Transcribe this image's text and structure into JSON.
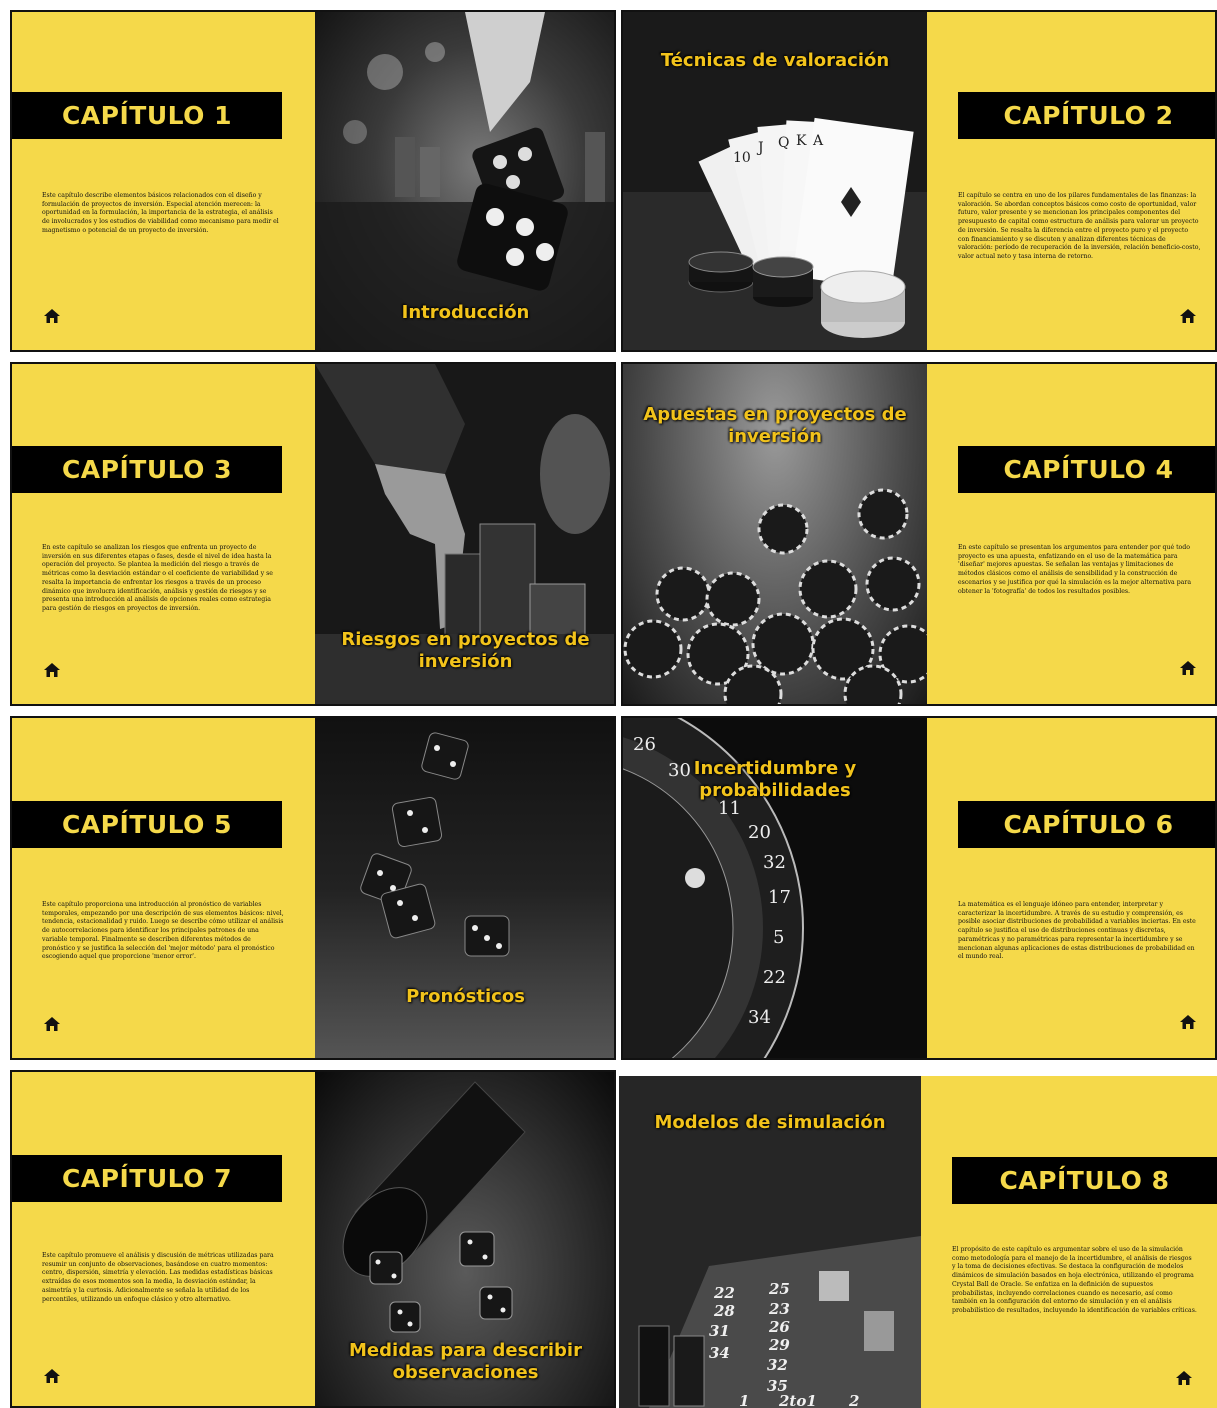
{
  "colors": {
    "accent_yellow": "#f5d94a",
    "band_black": "#000000",
    "photo_title_yellow": "#f2c31b"
  },
  "cards": [
    {
      "chapter": "CAPÍTULO 1",
      "photo_title": "Introducción",
      "description": "Este capítulo describe elementos básicos relacionados con el diseño y formulación de proyectos de inversión. Especial atención merecen: la oportunidad en la formulación, la importancia de la estrategia, el análisis de involucrados y los estudios de viabilidad como mecanismo para medir el magnetismo o potencial de un proyecto de inversión.",
      "icon": "home-icon"
    },
    {
      "chapter": "CAPÍTULO 2",
      "photo_title": "Técnicas de valoración",
      "description": "El capítulo se centra en uno de los pilares fundamentales de las finanzas: la valoración. Se abordan conceptos básicos como costo de oportunidad, valor futuro, valor presente y se mencionan los principales componentes del presupuesto de capital como estructura de análisis para valorar un proyecto de inversión. Se resalta la diferencia entre el proyecto puro y el proyecto con financiamiento y se discuten y analizan diferentes técnicas de valoración: período de recuperación de la inversión, relación beneficio-costo, valor actual neto y tasa interna de retorno.",
      "icon": "home-icon"
    },
    {
      "chapter": "CAPÍTULO 3",
      "photo_title": "Riesgos en proyectos de inversión",
      "description": "En este capítulo se analizan los riesgos que enfrenta un proyecto de inversión en sus diferentes etapas o fases, desde el nivel de idea hasta la operación del proyecto. Se plantea la medición del riesgo a través de métricas como la desviación estándar o el coeficiente de variabilidad y se resalta la importancia de enfrentar los riesgos a través de un proceso dinámico que involucra identificación, análisis y gestión de riesgos y se presenta una introducción al análisis de opciones reales como estrategia para gestión de riesgos en proyectos de inversión.",
      "icon": "home-icon"
    },
    {
      "chapter": "CAPÍTULO 4",
      "photo_title": "Apuestas en proyectos de inversión",
      "description": "En este capítulo se presentan los argumentos para entender por qué todo proyecto es una apuesta, enfatizando en el uso de la matemática para 'diseñar' mejores apuestas. Se señalan las ventajas y limitaciones de métodos clásicos como el análisis de sensibilidad y la construcción de escenarios y se justifica por qué la simulación es la mejor alternativa para obtener la 'fotografía' de todos los resultados posibles.",
      "icon": "home-icon"
    },
    {
      "chapter": "CAPÍTULO 5",
      "photo_title": "Pronósticos",
      "description": "Este capítulo proporciona una introducción al pronóstico de variables temporales, empezando por una descripción de sus elementos básicos: nivel, tendencia, estacionalidad y ruido. Luego se describe cómo utilizar el análisis de autocorrelaciones para identificar los principales patrones de una variable temporal. Finalmente se describen diferentes métodos de pronóstico y se justifica la selección del 'mejor método' para el pronóstico escogiendo aquel que proporcione 'menor error'.",
      "icon": "home-icon"
    },
    {
      "chapter": "CAPÍTULO 6",
      "photo_title": "Incertidumbre y probabilidades",
      "description": "La matemática es el lenguaje idóneo para entender, interpretar y caracterizar la incertidumbre. A través de su estudio y comprensión, es posible asociar distribuciones de probabilidad a variables inciertas. En este capítulo se justifica el uso de distribuciones continuas y discretas, paramétricas y no paramétricas para representar la incertidumbre y se mencionan algunas aplicaciones de estas distribuciones de probabilidad en el mundo real.",
      "icon": "home-icon"
    },
    {
      "chapter": "CAPÍTULO 7",
      "photo_title": "Medidas para describir observaciones",
      "description": "Este capítulo promueve el análisis y discusión de métricas utilizadas para resumir un conjunto de observaciones, basándose en cuatro momentos: centro, dispersión, simetría y elevación. Las medidas estadísticas básicas extraídas de esos momentos son la media, la desviación estándar, la asimetría y la curtosis. Adicionalmente se señala la utilidad de los percentiles, utilizando un enfoque clásico y otro alternativo.",
      "icon": "home-icon"
    },
    {
      "chapter": "CAPÍTULO 8",
      "photo_title": "Modelos de simulación",
      "description": "El propósito de este capítulo es argumentar sobre el uso de la simulación como metodología para el manejo de la incertidumbre, el análisis de riesgos y la toma de decisiones efectivas. Se destaca la configuración de modelos dinámicos de simulación basados en hoja electrónica, utilizando el programa Crystal Ball de Oracle. Se enfatiza en la definición de supuestos probabilistas, incluyendo correlaciones cuando es necesario, así como también en la configuración del entorno de simulación y en el análisis probabilístico de resultados, incluyendo la identificación de variables críticas.",
      "icon": "home-icon"
    }
  ],
  "photo_details": {
    "card2_cards": [
      "10",
      "J",
      "Q",
      "K",
      "A"
    ],
    "card6_numbers": [
      "26",
      "30",
      "11",
      "20",
      "32",
      "17",
      "5",
      "22",
      "34"
    ],
    "card8_table_numbers": [
      "22",
      "25",
      "28",
      "31",
      "34",
      "23",
      "26",
      "29",
      "32",
      "35",
      "1",
      "2to1",
      "2"
    ]
  }
}
